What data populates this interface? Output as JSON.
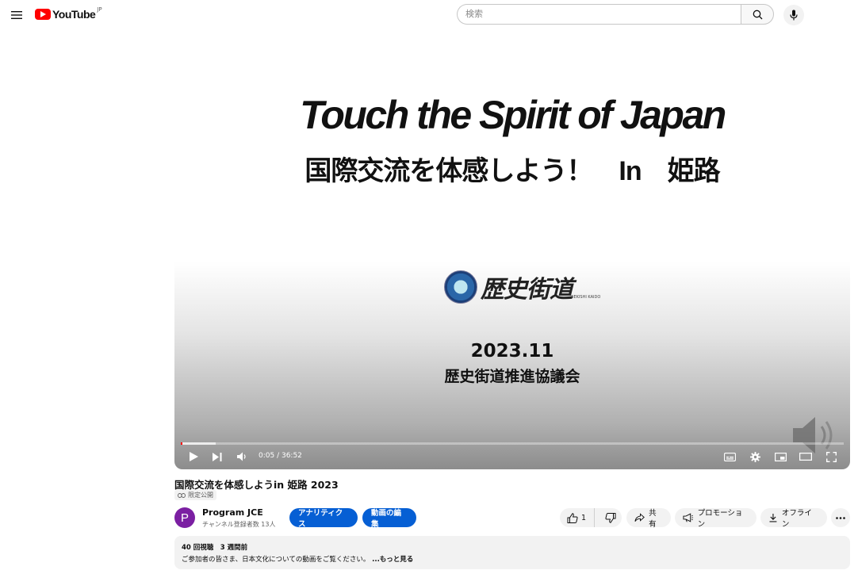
{
  "header": {
    "logo_text": "YouTube",
    "logo_region": "JP",
    "search_placeholder": "検索"
  },
  "player": {
    "slide": {
      "title": "Touch the Spirit of Japan",
      "subtitle": "国際交流を体感しよう！　In　姫路",
      "logo_text": "歴史街道",
      "logo_sub": "REKISHI KAIDO",
      "date": "2023.11",
      "org": "歴史街道推進協議会"
    },
    "time": "0:05 / 36:52",
    "progress": {
      "played_fraction": 0.002,
      "buffered_fraction": 0.053
    }
  },
  "video": {
    "title": "国際交流を体感しようin 姫路 2023",
    "privacy": "限定公開",
    "channel": {
      "avatar_letter": "P",
      "name": "Program JCE",
      "subscribers": "チャンネル登録者数 13人"
    },
    "buttons": {
      "analytics": "アナリティクス",
      "edit": "動画の編集",
      "like_count": "1",
      "share": "共有",
      "promote": "プロモーション",
      "offline": "オフライン"
    },
    "description": {
      "stats": "40 回視聴　3 週間前",
      "text": "ご参加者の皆さま、日本文化についての動画をご覧ください。",
      "more": "...もっと見る"
    }
  },
  "colors": {
    "brand_red": "#ff0000",
    "accent_blue": "#065fd4",
    "avatar_purple": "#7b1fa2"
  }
}
